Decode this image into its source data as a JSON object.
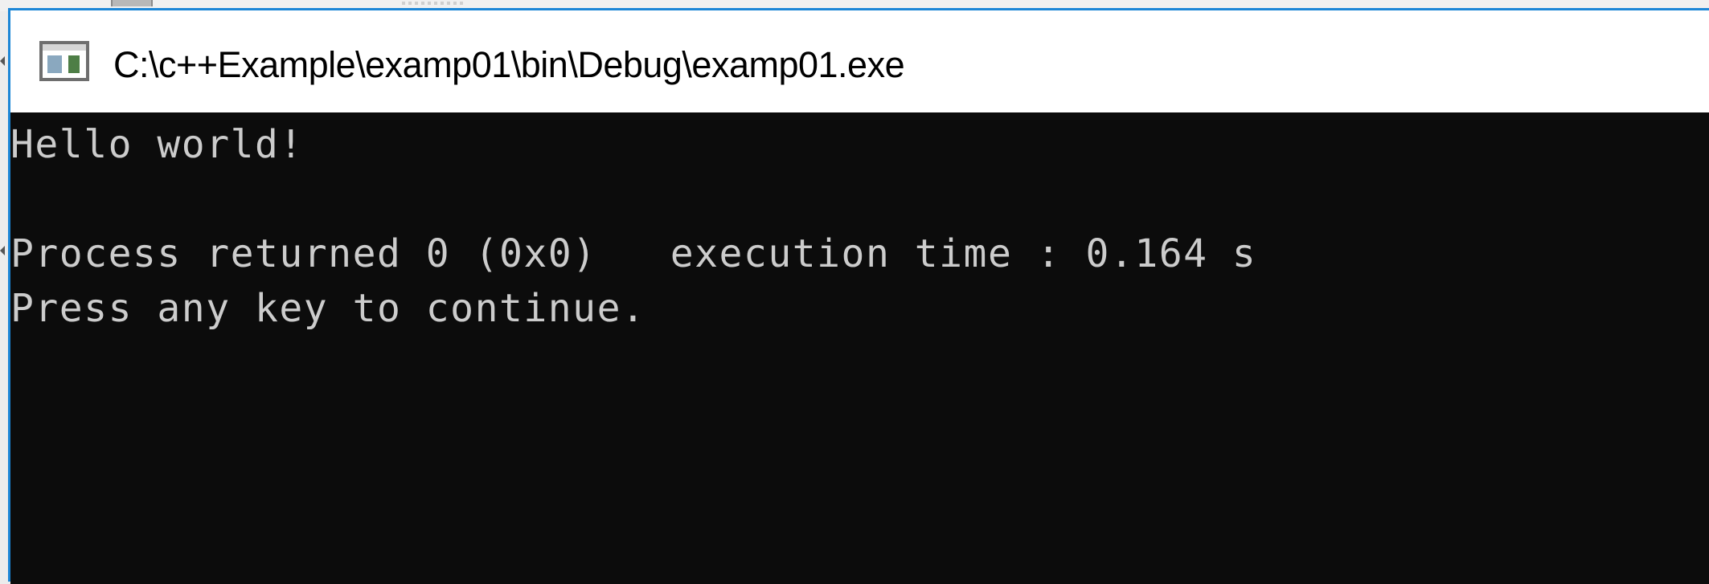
{
  "window": {
    "title": "C:\\c++Example\\examp01\\bin\\Debug\\examp01.exe",
    "icon": "console-app-icon"
  },
  "console": {
    "lines": [
      "Hello world!",
      "",
      "Process returned 0 (0x0)   execution time : 0.164 s",
      "Press any key to continue."
    ],
    "background_color": "#0c0c0c",
    "text_color": "#cccccc"
  },
  "colors": {
    "window_border": "#1c86d6",
    "title_bar": "#ffffff"
  }
}
